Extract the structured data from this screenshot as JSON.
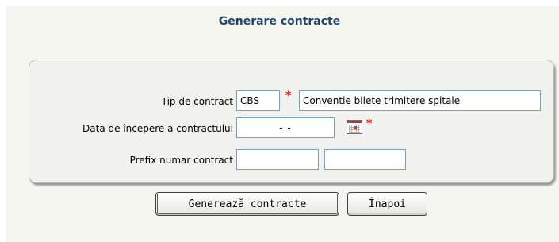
{
  "page": {
    "title": "Generare contracte"
  },
  "form": {
    "contract_type": {
      "label": "Tip de contract",
      "code": "CBS",
      "description": "Conventie bilete trimitere spitale",
      "required_mark": "*"
    },
    "start_date": {
      "label": "Data de începere a contractului",
      "value": "-  -",
      "required_mark": "*"
    },
    "prefix": {
      "label": "Prefix numar contract",
      "value1": "",
      "value2": ""
    }
  },
  "buttons": {
    "generate_label": "Generează contracte",
    "back_label": "Înapoi"
  },
  "colors": {
    "title": "#23456b",
    "required": "#ff0000",
    "field_border": "#7f9db9",
    "panel_bg": "#f1f1ef"
  }
}
